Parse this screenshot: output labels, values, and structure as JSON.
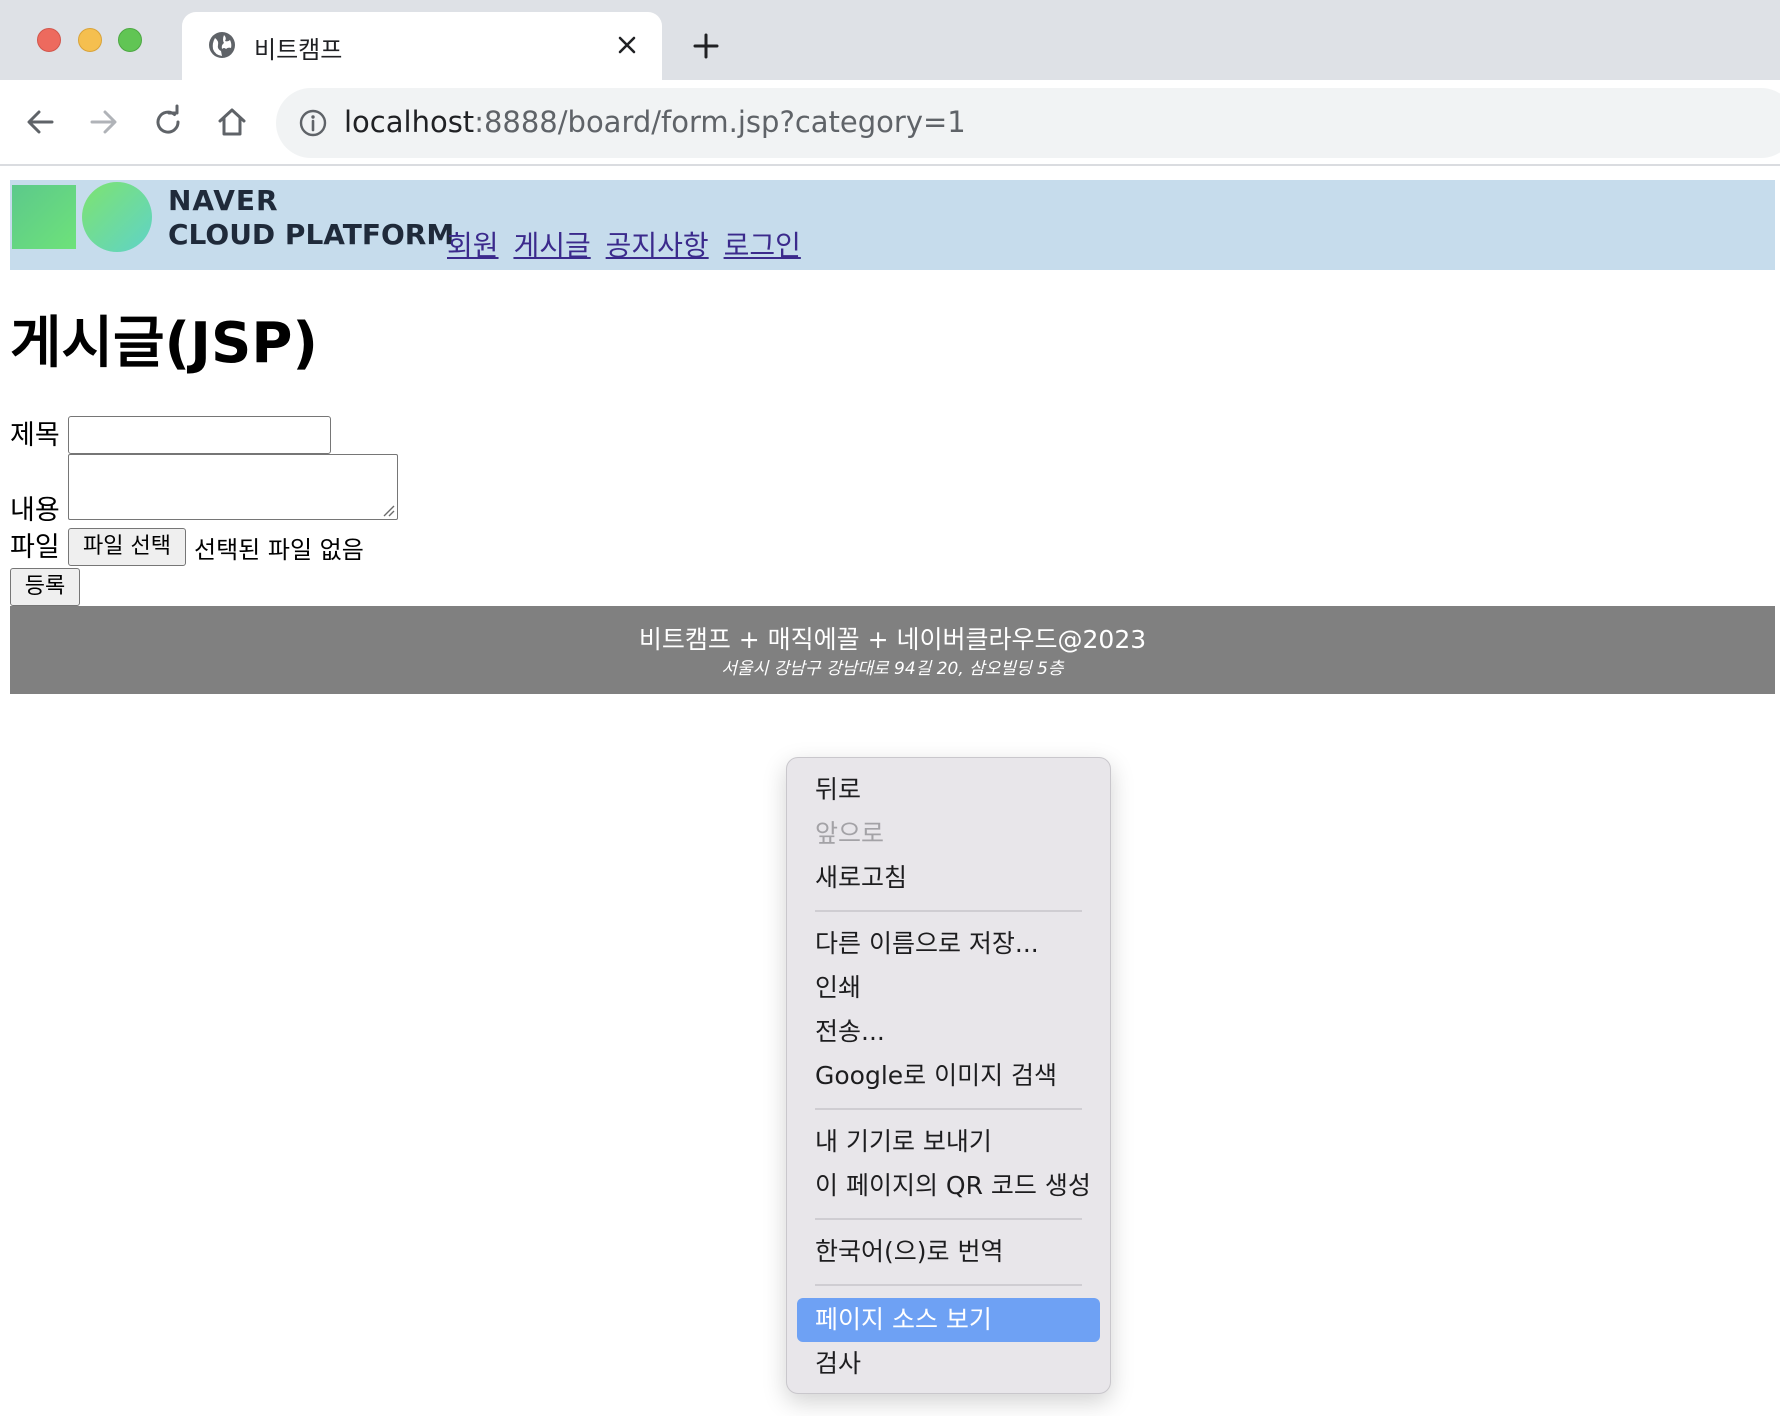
{
  "browser": {
    "tab_title": "비트캠프",
    "url_host": "localhost",
    "url_path": ":8888/board/form.jsp?category=1"
  },
  "header": {
    "logo_line1": "NAVER",
    "logo_line2": "CLOUD PLATFORM",
    "nav": [
      "회원",
      "게시글",
      "공지사항",
      "로그인"
    ]
  },
  "form": {
    "page_title": "게시글(JSP)",
    "title_label": "제목",
    "title_value": "",
    "content_label": "내용",
    "content_value": "",
    "file_label": "파일",
    "file_button": "파일 선택",
    "file_status": "선택된 파일 없음",
    "submit_button": "등록"
  },
  "footer": {
    "line1": "비트캠프 + 매직에꼴 + 네이버클라우드@2023",
    "line2": "서울시 강남구 강남대로 94길 20, 삼오빌딩 5층"
  },
  "context_menu": {
    "back": "뒤로",
    "forward": "앞으로",
    "reload": "새로고침",
    "save_as": "다른 이름으로 저장...",
    "print": "인쇄",
    "cast": "전송...",
    "search_image": "Google로 이미지 검색",
    "send_to_device": "내 기기로 보내기",
    "qr_code": "이 페이지의 QR 코드 생성",
    "translate": "한국어(으)로 번역",
    "view_source": "페이지 소스 보기",
    "inspect": "검사"
  },
  "colors": {
    "header_bg": "#c6dcec",
    "footer_bg": "#808080",
    "menu_highlight": "#6ea1f4",
    "link": "#3b2a8c"
  }
}
